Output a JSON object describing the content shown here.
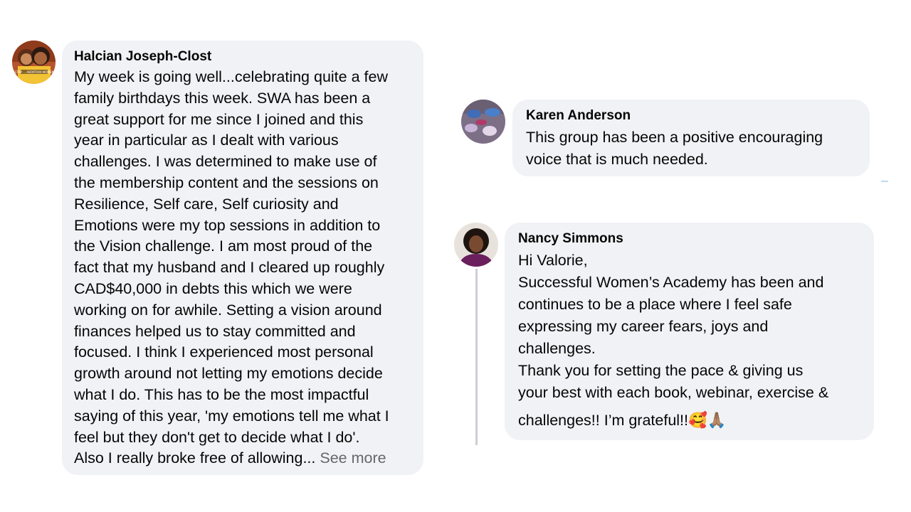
{
  "comments": [
    {
      "author": "Halcian Joseph-Clost",
      "lines": [
        "My week is going well...celebrating quite a few",
        "family birthdays this week. SWA has been a",
        "great support for me since I joined and this",
        "year in particular as I dealt with various",
        "challenges. I was determined to make use of",
        "the membership content and the sessions on",
        "Resilience, Self care, Self curiosity and",
        "Emotions were my top sessions in addition to",
        "the Vision challenge. I am most proud of the",
        "fact that my husband and I cleared up roughly",
        "CAD$40,000 in debts this which we were",
        "working on for awhile. Setting a vision around",
        "finances helped us to stay committed and",
        "focused. I think I experienced most personal",
        "growth around not letting my emotions decide",
        "what I do. This has to be the most impactful",
        "saying of this year, 'my emotions tell me what I",
        "feel  but they don't get to decide what I do'."
      ],
      "truncated_line": "Also I really broke free of allowing...",
      "see_more": "See more",
      "avatar_caption": "STOP ... ABORTION WOMEN"
    },
    {
      "author": "Karen Anderson",
      "lines": [
        "This group has been a positive encouraging",
        "voice that is much needed."
      ]
    },
    {
      "author": "Nancy Simmons",
      "lines": [
        "Hi Valorie,",
        "Successful Women’s Academy has been and",
        "continues to be a place where I feel safe",
        "expressing my career fears, joys and",
        "challenges.",
        "Thank you for setting the pace & giving us",
        "your best with each book, webinar, exercise &"
      ],
      "last_line": "challenges!! I’m grateful!!🥰🙏🏽"
    }
  ],
  "colors": {
    "bubble_bg": "#f0f2f5",
    "text": "#050505",
    "see_more": "#65676b",
    "thread_line": "#ccd0d5"
  }
}
